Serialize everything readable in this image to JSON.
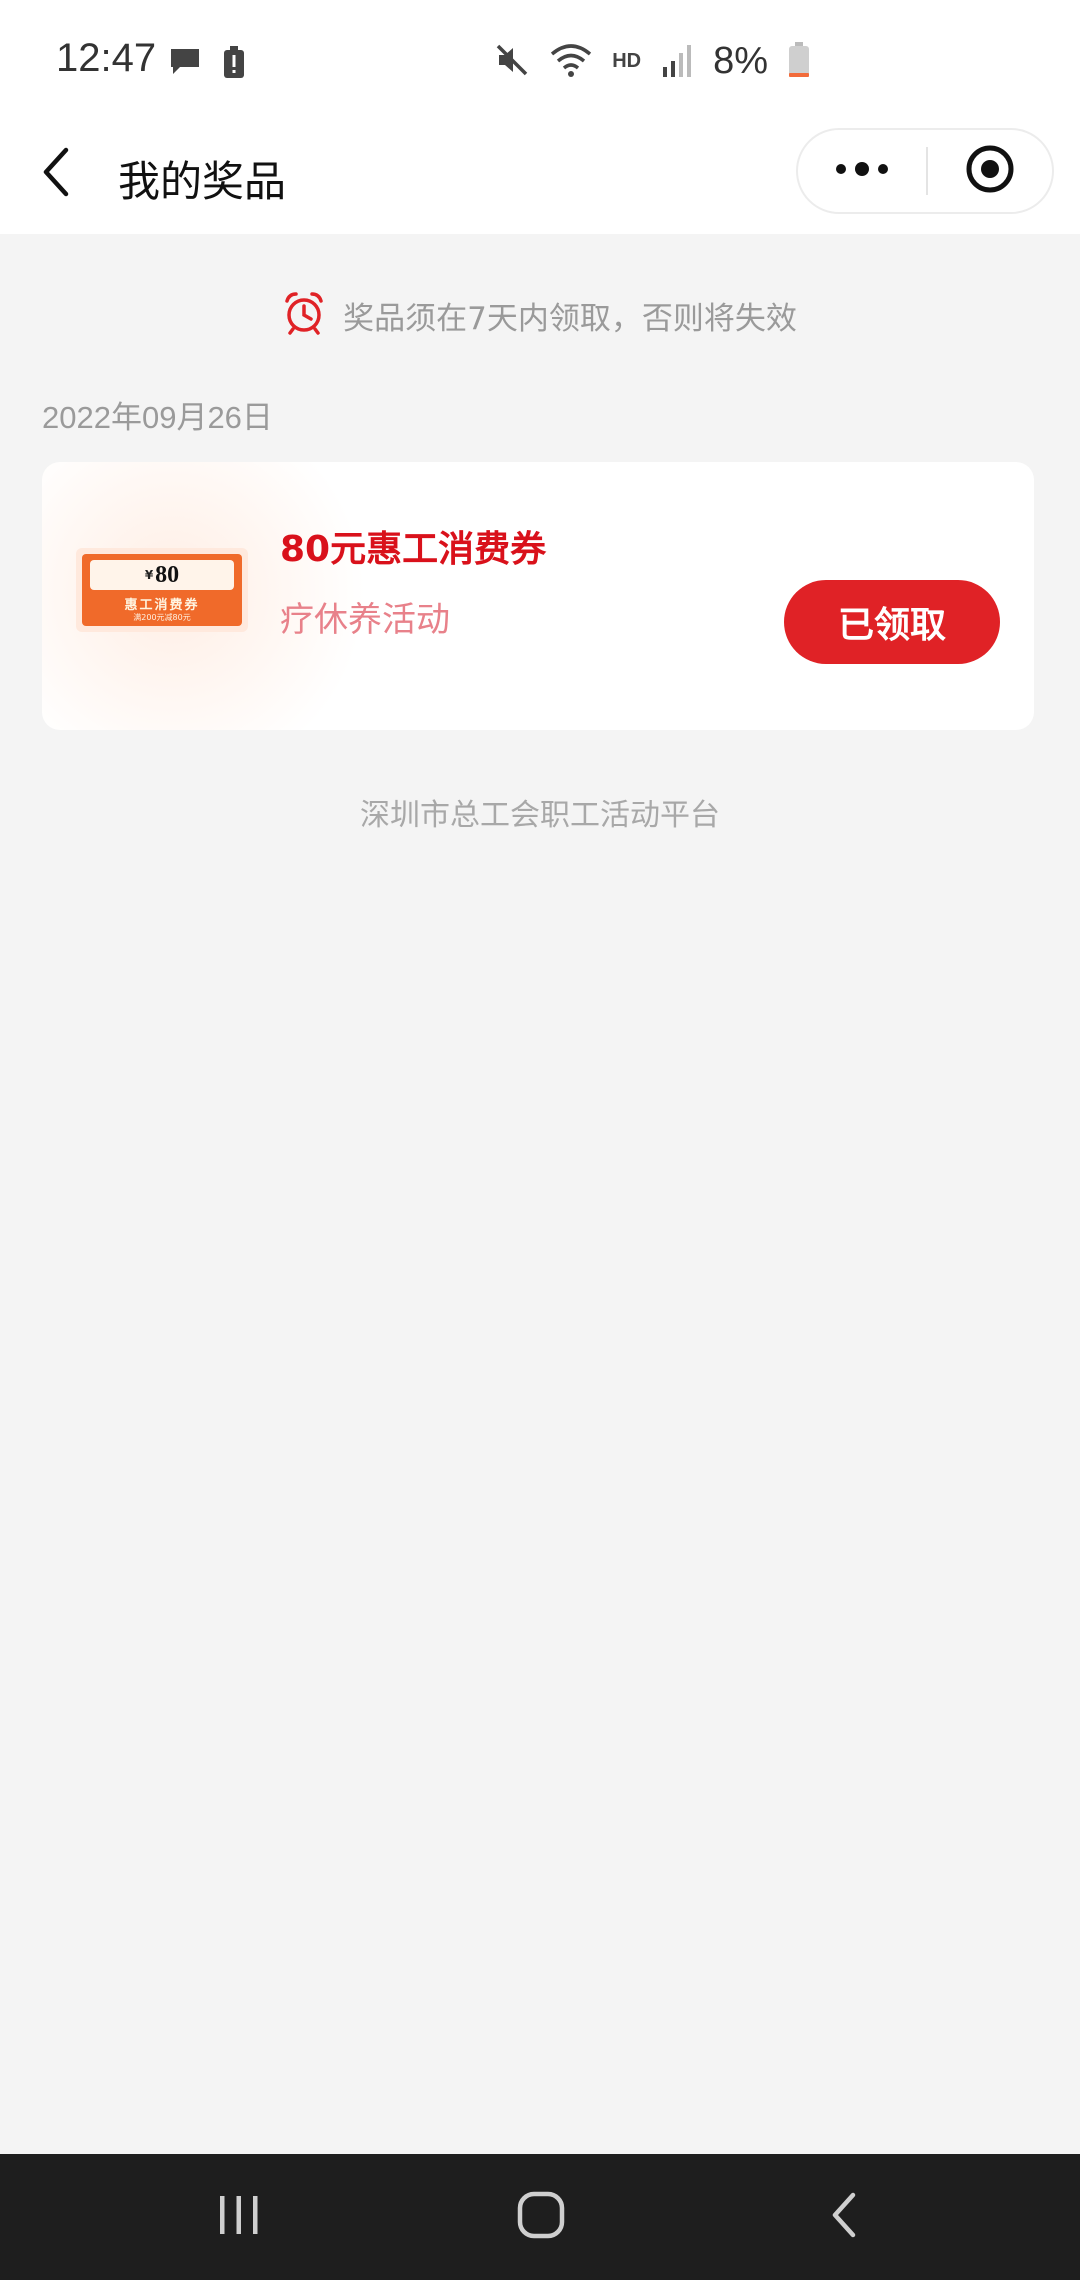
{
  "status_bar": {
    "time": "12:47",
    "network_label": "HD",
    "battery": "8%",
    "icons": [
      "chat-bubble-icon",
      "alert-battery-icon",
      "mute-icon",
      "wifi-icon",
      "signal-icon",
      "battery-icon"
    ]
  },
  "nav": {
    "title": "我的奖品",
    "icons": [
      "back-arrow-icon",
      "more-dots-icon",
      "target-circle-icon"
    ]
  },
  "notice": {
    "text": "奖品须在7天内领取，否则将失效",
    "icon": "alarm-clock-icon",
    "color": "#e02226"
  },
  "prizes": [
    {
      "date": "2022年09月26日",
      "coupon": {
        "currency": "¥",
        "amount": "80",
        "label": "惠工消费券",
        "condition": "满200元减80元"
      },
      "name": "80元惠工消费券",
      "activity": "疗休养活动",
      "button": "已领取"
    }
  ],
  "footer": "深圳市总工会职工活动平台",
  "system_nav": {
    "icons": [
      "recent-apps-icon",
      "home-icon",
      "system-back-icon"
    ]
  },
  "colors": {
    "accent_red": "#e02226",
    "prize_name": "#d9111b",
    "activity": "#e8818a",
    "muted_text": "#9a9a9a",
    "background": "#f4f4f4"
  }
}
